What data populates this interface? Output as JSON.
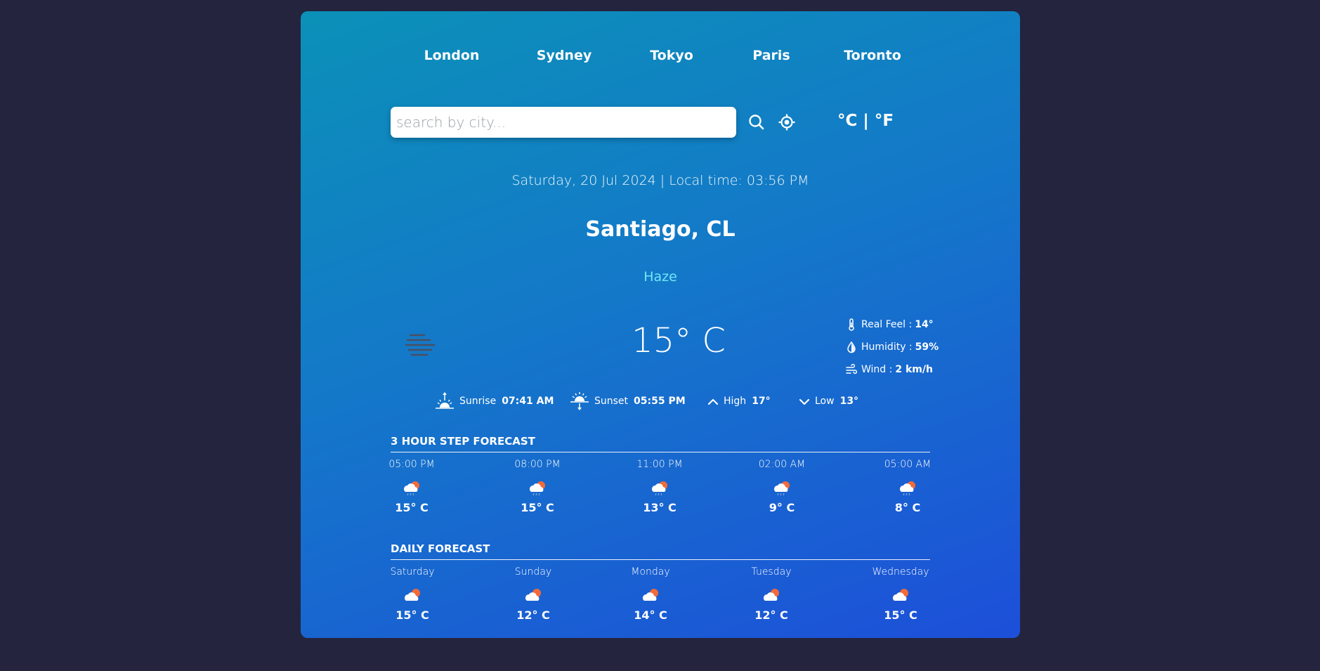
{
  "nav": {
    "cities": [
      "London",
      "Sydney",
      "Tokyo",
      "Paris",
      "Toronto"
    ]
  },
  "search": {
    "placeholder": "search by city...",
    "value": ""
  },
  "units": {
    "celsius": "°C",
    "separator": "|",
    "fahrenheit": "°F"
  },
  "current": {
    "datetime": "Saturday, 20 Jul 2024 | Local time: 03:56 PM",
    "location": "Santiago, CL",
    "condition": "Haze",
    "temperature": "15° C",
    "icon": "haze-icon",
    "details": {
      "real_feel_label": "Real Feel :",
      "real_feel_value": "14°",
      "humidity_label": "Humidity :",
      "humidity_value": "59%",
      "wind_label": "Wind :",
      "wind_value": "2 km/h"
    }
  },
  "sun": {
    "sunrise_label": "Sunrise",
    "sunrise_value": "07:41 AM",
    "sunset_label": "Sunset",
    "sunset_value": "05:55 PM",
    "high_label": "High",
    "high_value": "17°",
    "low_label": "Low",
    "low_value": "13°"
  },
  "hourly": {
    "title": "3 hour step forecast",
    "items": [
      {
        "label": "05:00 PM",
        "temp": "15° C",
        "icon": "cloud-rain-sun-icon"
      },
      {
        "label": "08:00 PM",
        "temp": "15° C",
        "icon": "cloud-rain-sun-icon"
      },
      {
        "label": "11:00 PM",
        "temp": "13° C",
        "icon": "cloud-rain-sun-icon"
      },
      {
        "label": "02:00 AM",
        "temp": "9° C",
        "icon": "cloud-rain-sun-icon"
      },
      {
        "label": "05:00 AM",
        "temp": "8° C",
        "icon": "cloud-rain-sun-icon"
      }
    ]
  },
  "daily": {
    "title": "daily forecast",
    "items": [
      {
        "label": "Saturday",
        "temp": "15° C",
        "icon": "cloud-sun-icon"
      },
      {
        "label": "Sunday",
        "temp": "12° C",
        "icon": "cloud-sun-icon"
      },
      {
        "label": "Monday",
        "temp": "14° C",
        "icon": "cloud-sun-icon"
      },
      {
        "label": "Tuesday",
        "temp": "12° C",
        "icon": "cloud-sun-icon"
      },
      {
        "label": "Wednesday",
        "temp": "15° C",
        "icon": "cloud-sun-icon"
      }
    ]
  },
  "colors": {
    "page_background": "#24243f",
    "card_gradient_start": "#0b91b8",
    "card_gradient_end": "#1d4fd9",
    "condition_text": "#6fe7f5",
    "sun_accent": "#f26b3a"
  }
}
